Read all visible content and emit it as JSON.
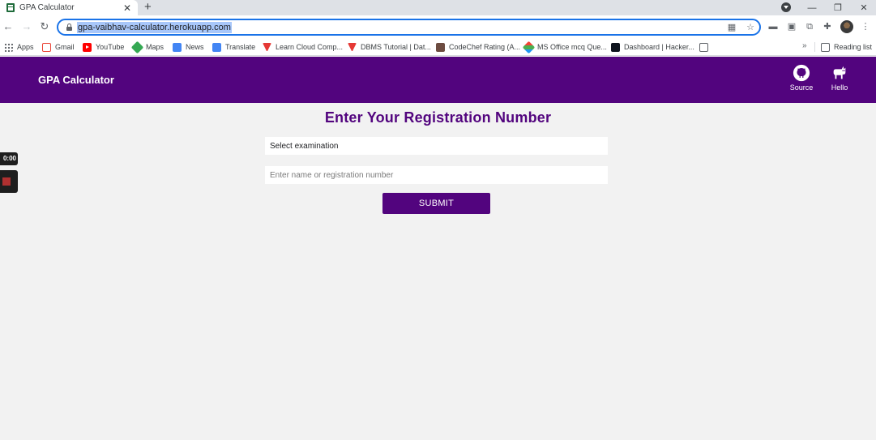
{
  "browser": {
    "tab_title": "GPA Calculator",
    "tab_close": "✕",
    "new_tab": "+",
    "url": "gpa-vaibhav-calculator.herokuapp.com",
    "window_controls": {
      "minimize": "—",
      "restore": "❐",
      "close": "✕"
    }
  },
  "bookmarks": {
    "items": [
      {
        "label": "Apps",
        "icon": "apps-grid-icon"
      },
      {
        "label": "Gmail",
        "icon": "gmail-icon"
      },
      {
        "label": "YouTube",
        "icon": "youtube-icon"
      },
      {
        "label": "Maps",
        "icon": "maps-icon"
      },
      {
        "label": "News",
        "icon": "news-icon"
      },
      {
        "label": "Translate",
        "icon": "translate-icon"
      },
      {
        "label": "Learn Cloud Comp...",
        "icon": "triangle-icon"
      },
      {
        "label": "DBMS Tutorial | Dat...",
        "icon": "triangle-icon"
      },
      {
        "label": "CodeChef Rating (A...",
        "icon": "codechef-icon"
      },
      {
        "label": "MS Office mcq Que...",
        "icon": "ms-icon"
      },
      {
        "label": "Dashboard | Hacker...",
        "icon": "hackerrank-icon"
      }
    ],
    "more": "»",
    "reading_list": "Reading list"
  },
  "app": {
    "brand": "GPA Calculator",
    "links": [
      {
        "label": "Source",
        "icon": "github-icon"
      },
      {
        "label": "Hello",
        "icon": "cat-icon"
      }
    ],
    "accent_color": "#52047e"
  },
  "form": {
    "heading": "Enter Your Registration Number",
    "select_placeholder": "Select examination",
    "input_placeholder": "Enter name or registration number",
    "submit_label": "SUBMIT"
  },
  "recorder": {
    "time": "0:00"
  }
}
